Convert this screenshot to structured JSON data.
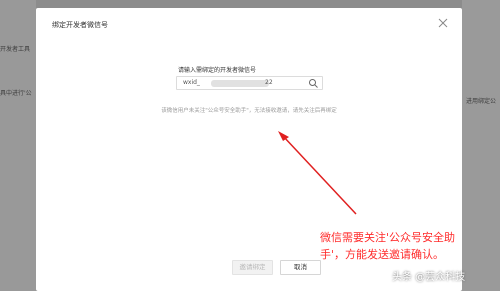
{
  "background": {
    "left_items": [
      "开发者工具",
      "具中进行'公"
    ],
    "right_items": [
      "进用绑定公"
    ]
  },
  "dialog": {
    "title": "绑定开发者微信号",
    "input_label": "请输入需绑定的开发者微信号",
    "input_value_prefix": "wxid_",
    "input_value_suffix": "22",
    "hint": "该微信用户未关注\"公众号安全助手\"，无法接收邀请，请先关注后再绑定",
    "confirm_label": "邀请绑定",
    "cancel_label": "取消"
  },
  "annotation": {
    "text": "微信需要关注'公众号安全助手'，方能发送邀请确认。"
  },
  "watermark": {
    "text": "头条 @芸众科技"
  },
  "colors": {
    "overlay": "#8c8c8c",
    "annotation": "#ff2b2b",
    "hint": "#9a9a9a"
  },
  "icons": [
    "close-icon",
    "search-icon",
    "annotation-arrow"
  ]
}
